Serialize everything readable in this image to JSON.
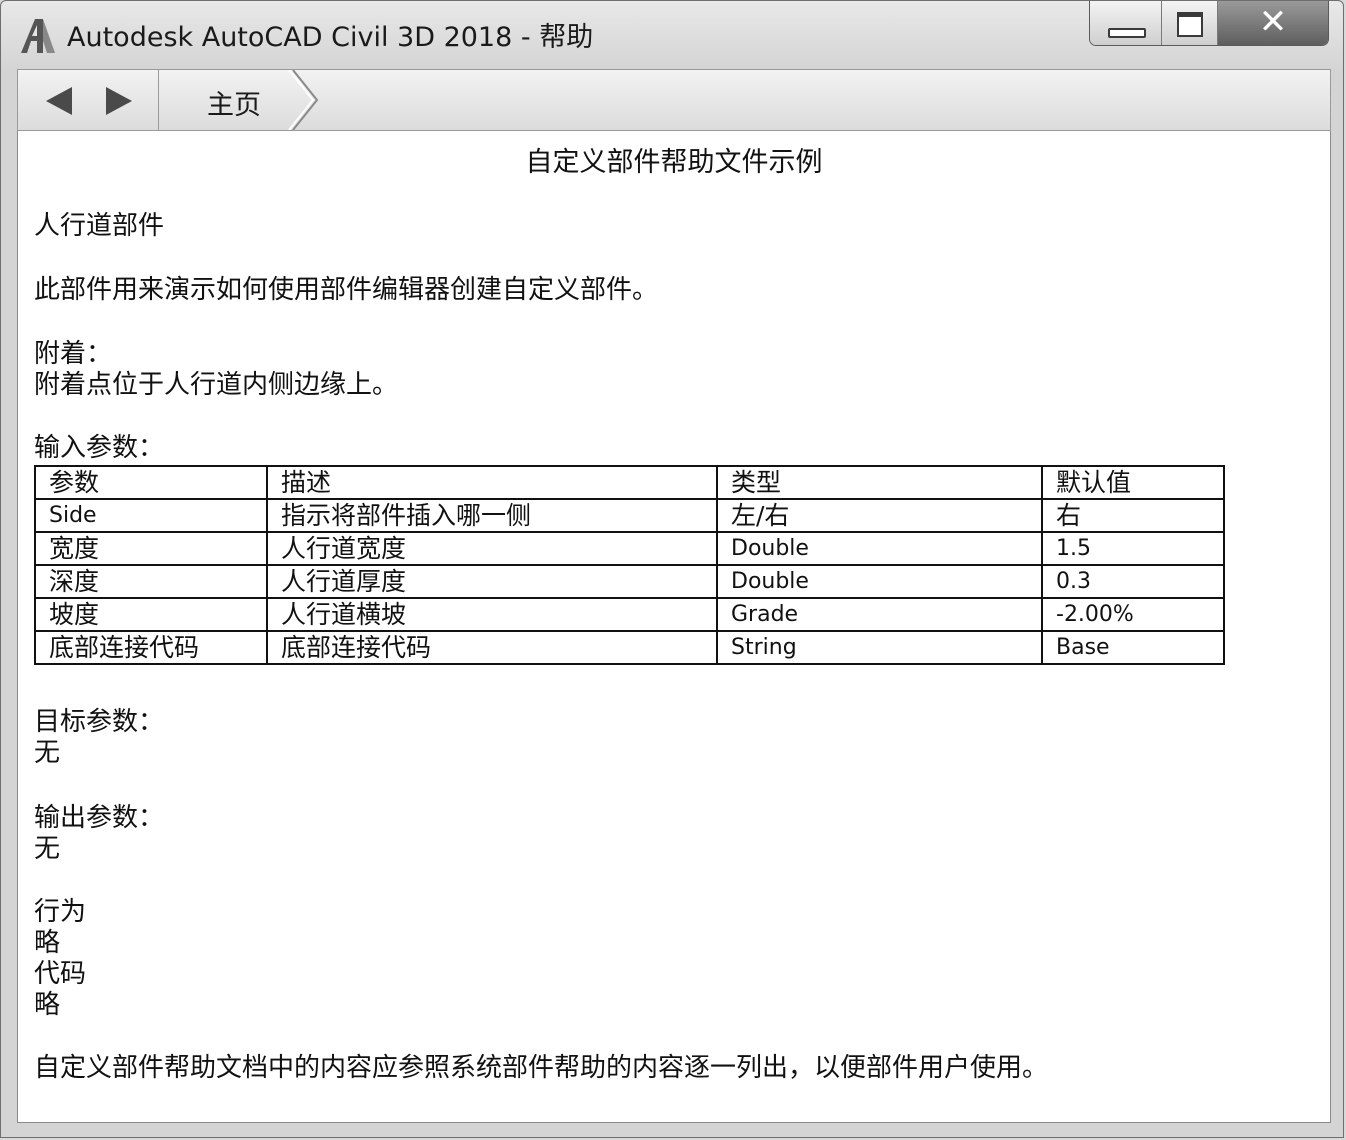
{
  "window": {
    "title": "Autodesk AutoCAD Civil 3D 2018 - 帮助",
    "logo_icon": "autodesk-a-logo",
    "controls": {
      "minimize_icon": "minimize-icon",
      "maximize_icon": "maximize-icon",
      "close_icon": "close-icon"
    }
  },
  "nav": {
    "back_icon": "back-arrow-icon",
    "forward_icon": "forward-arrow-icon",
    "breadcrumb_home": "主页"
  },
  "doc": {
    "title": "自定义部件帮助文件示例",
    "subassembly_name": "人行道部件",
    "description": "此部件用来演示如何使用部件编辑器创建自定义部件。",
    "attachment_heading": "附着：",
    "attachment_text": "附着点位于人行道内侧边缘上。",
    "input_heading": "输入参数：",
    "table": {
      "headers": [
        "参数",
        "描述",
        "类型",
        "默认值"
      ],
      "rows": [
        [
          "Side",
          "指示将部件插入哪一侧",
          "左/右",
          "右"
        ],
        [
          "宽度",
          "人行道宽度",
          "Double",
          "1.5"
        ],
        [
          "深度",
          "人行道厚度",
          "Double",
          "0.3"
        ],
        [
          "坡度",
          "人行道横坡",
          "Grade",
          "-2.00%"
        ],
        [
          "底部连接代码",
          "底部连接代码",
          "String",
          "Base"
        ]
      ]
    },
    "target_heading": "目标参数：",
    "target_value": "无",
    "output_heading": "输出参数：",
    "output_value": "无",
    "behavior_heading": "行为",
    "behavior_value": "略",
    "code_heading": "代码",
    "code_value": "略",
    "footer_note": "自定义部件帮助文档中的内容应参照系统部件帮助的内容逐一列出，以便部件用户使用。"
  }
}
